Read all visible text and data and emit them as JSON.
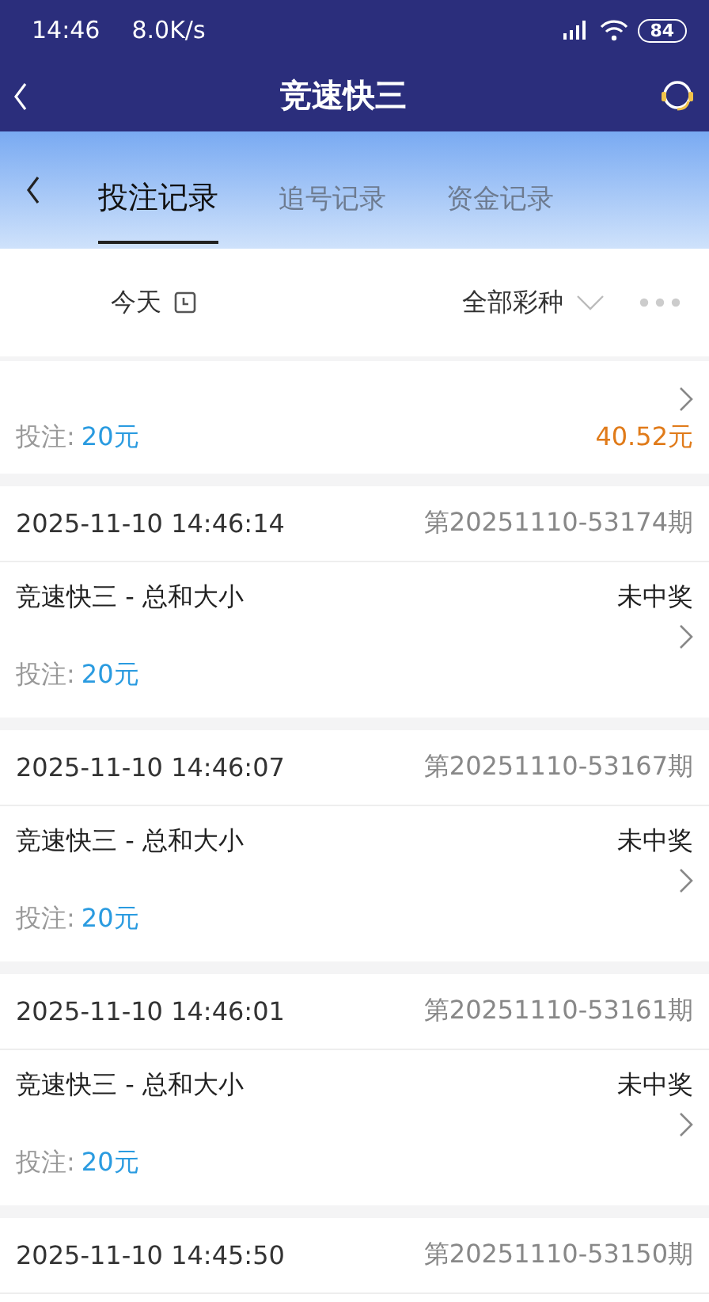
{
  "status_bar": {
    "time": "14:46",
    "speed": "8.0K/s",
    "battery": "84"
  },
  "header": {
    "title": "竞速快三"
  },
  "tabs": [
    {
      "label": "投注记录",
      "selected": true
    },
    {
      "label": "追号记录",
      "selected": false
    },
    {
      "label": "资金记录",
      "selected": false
    }
  ],
  "filters": {
    "date": "今天",
    "lottery": "全部彩种"
  },
  "partial_record": {
    "bet_label": "投注:",
    "bet_amount": "20元",
    "payout": "40.52元"
  },
  "records": [
    {
      "time": "2025-11-10 14:46:14",
      "period": "第20251110-53174期",
      "title": "竞速快三 - 总和大小",
      "status": "未中奖",
      "bet_label": "投注:",
      "bet_amount": "20元"
    },
    {
      "time": "2025-11-10 14:46:07",
      "period": "第20251110-53167期",
      "title": "竞速快三 - 总和大小",
      "status": "未中奖",
      "bet_label": "投注:",
      "bet_amount": "20元"
    },
    {
      "time": "2025-11-10 14:46:01",
      "period": "第20251110-53161期",
      "title": "竞速快三 - 总和大小",
      "status": "未中奖",
      "bet_label": "投注:",
      "bet_amount": "20元"
    },
    {
      "time": "2025-11-10 14:45:50",
      "period": "第20251110-53150期"
    }
  ]
}
